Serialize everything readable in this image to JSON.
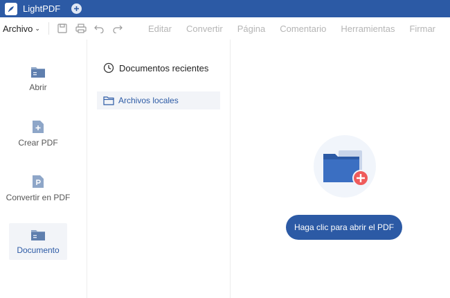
{
  "app": {
    "title": "LightPDF"
  },
  "menubar": {
    "archivo_label": "Archivo",
    "items": [
      "Editar",
      "Convertir",
      "Página",
      "Comentario",
      "Herramientas",
      "Firmar"
    ]
  },
  "leftnav": {
    "items": [
      {
        "label": "Abrir",
        "icon": "folder-icon"
      },
      {
        "label": "Crear PDF",
        "icon": "create-pdf-icon"
      },
      {
        "label": "Convertir en PDF",
        "icon": "convert-pdf-icon"
      },
      {
        "label": "Documento",
        "icon": "document-folder-icon",
        "active": true
      }
    ]
  },
  "midpanel": {
    "recent_label": "Documentos recientes",
    "local_label": "Archivos locales"
  },
  "main": {
    "open_button_label": "Haga clic para abrir el PDF"
  },
  "colors": {
    "brand": "#2c5aa5",
    "accent_red": "#ef5b5b",
    "selected_bg": "#f2f4f8"
  }
}
